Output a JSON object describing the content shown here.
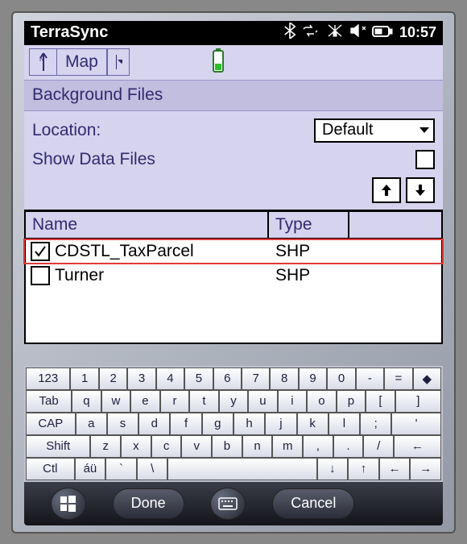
{
  "statusbar": {
    "title": "TerraSync",
    "time": "10:57"
  },
  "toolbar": {
    "map_label": "Map"
  },
  "section": {
    "title": "Background Files"
  },
  "form": {
    "location_label": "Location:",
    "location_value": "Default",
    "show_data_label": "Show Data Files",
    "show_data_checked": false
  },
  "table": {
    "headers": {
      "name": "Name",
      "type": "Type"
    },
    "rows": [
      {
        "checked": true,
        "name": "CDSTL_TaxParcel",
        "type": "SHP",
        "highlighted": true
      },
      {
        "checked": false,
        "name": "Turner",
        "type": "SHP",
        "highlighted": false
      }
    ]
  },
  "keyboard": {
    "r0": [
      "123",
      "1",
      "2",
      "3",
      "4",
      "5",
      "6",
      "7",
      "8",
      "9",
      "0",
      "-",
      "=",
      "◆"
    ],
    "r1": [
      "Tab",
      "q",
      "w",
      "e",
      "r",
      "t",
      "y",
      "u",
      "i",
      "o",
      "p",
      "[",
      "]"
    ],
    "r2": [
      "CAP",
      "a",
      "s",
      "d",
      "f",
      "g",
      "h",
      "j",
      "k",
      "l",
      ";",
      "'"
    ],
    "r3": [
      "Shift",
      "z",
      "x",
      "c",
      "v",
      "b",
      "n",
      "m",
      ",",
      ".",
      "/",
      "←"
    ],
    "r4": [
      "Ctl",
      "áü",
      "`",
      "\\",
      " ",
      "↓",
      "↑",
      "←",
      "→"
    ]
  },
  "softbar": {
    "done": "Done",
    "cancel": "Cancel"
  }
}
